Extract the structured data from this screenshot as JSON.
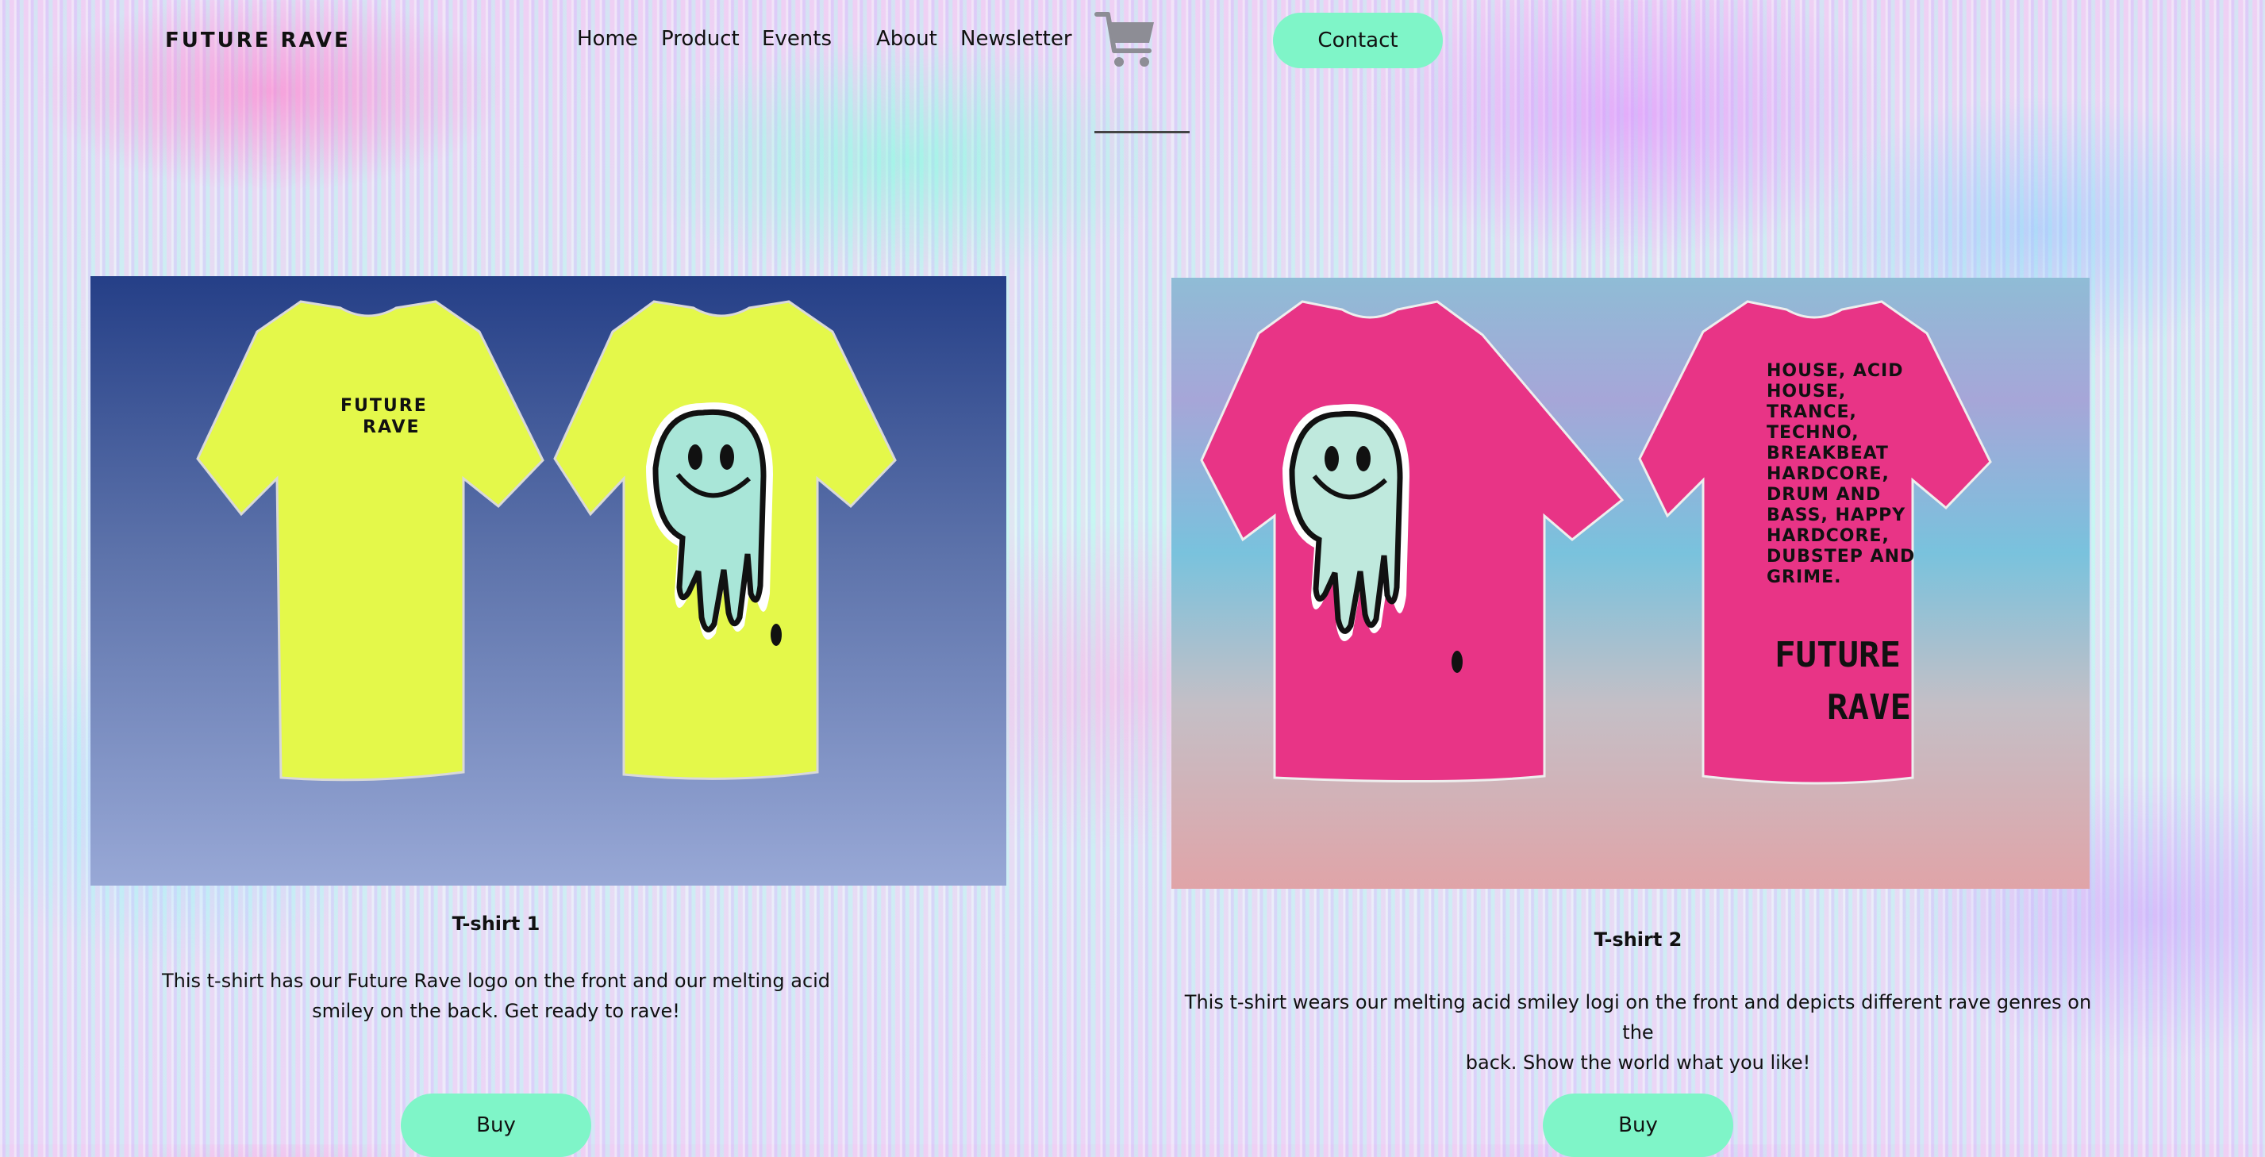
{
  "brand": {
    "logo": "FUTURE RAVE"
  },
  "nav": {
    "items": [
      {
        "label": "Home"
      },
      {
        "label": "Product"
      },
      {
        "label": "Events"
      },
      {
        "label": "About"
      },
      {
        "label": "Newsletter"
      }
    ],
    "cart_icon": "shopping-cart-icon",
    "contact_label": "Contact"
  },
  "products": [
    {
      "title": "T-shirt 1",
      "description_line1": "This t-shirt has our Future Rave logo on the front and our melting acid",
      "description_line2": "smiley on the back. Get ready to rave!",
      "buy_label": "Buy",
      "shirt_color": "#e4f84a",
      "front_print": [
        "FUTURE",
        "RAVE"
      ]
    },
    {
      "title": "T-shirt 2",
      "description_line1": "This t-shirt wears our melting acid smiley logi on the front and depicts different rave genres on the",
      "description_line2": "back. Show the world what you like!",
      "buy_label": "Buy",
      "shirt_color": "#e83486",
      "back_print": [
        "HOUSE, ACID",
        "HOUSE,",
        "TRANCE,",
        "TECHNO,",
        "BREAKBEAT",
        "HARDCORE,",
        "DRUM AND",
        "BASS, HAPPY",
        "HARDCORE,",
        "DUBSTEP AND",
        "GRIME."
      ],
      "back_logo": [
        "FUTURE",
        "RAVE"
      ]
    }
  ],
  "colors": {
    "accent": "#7ff5c8"
  }
}
